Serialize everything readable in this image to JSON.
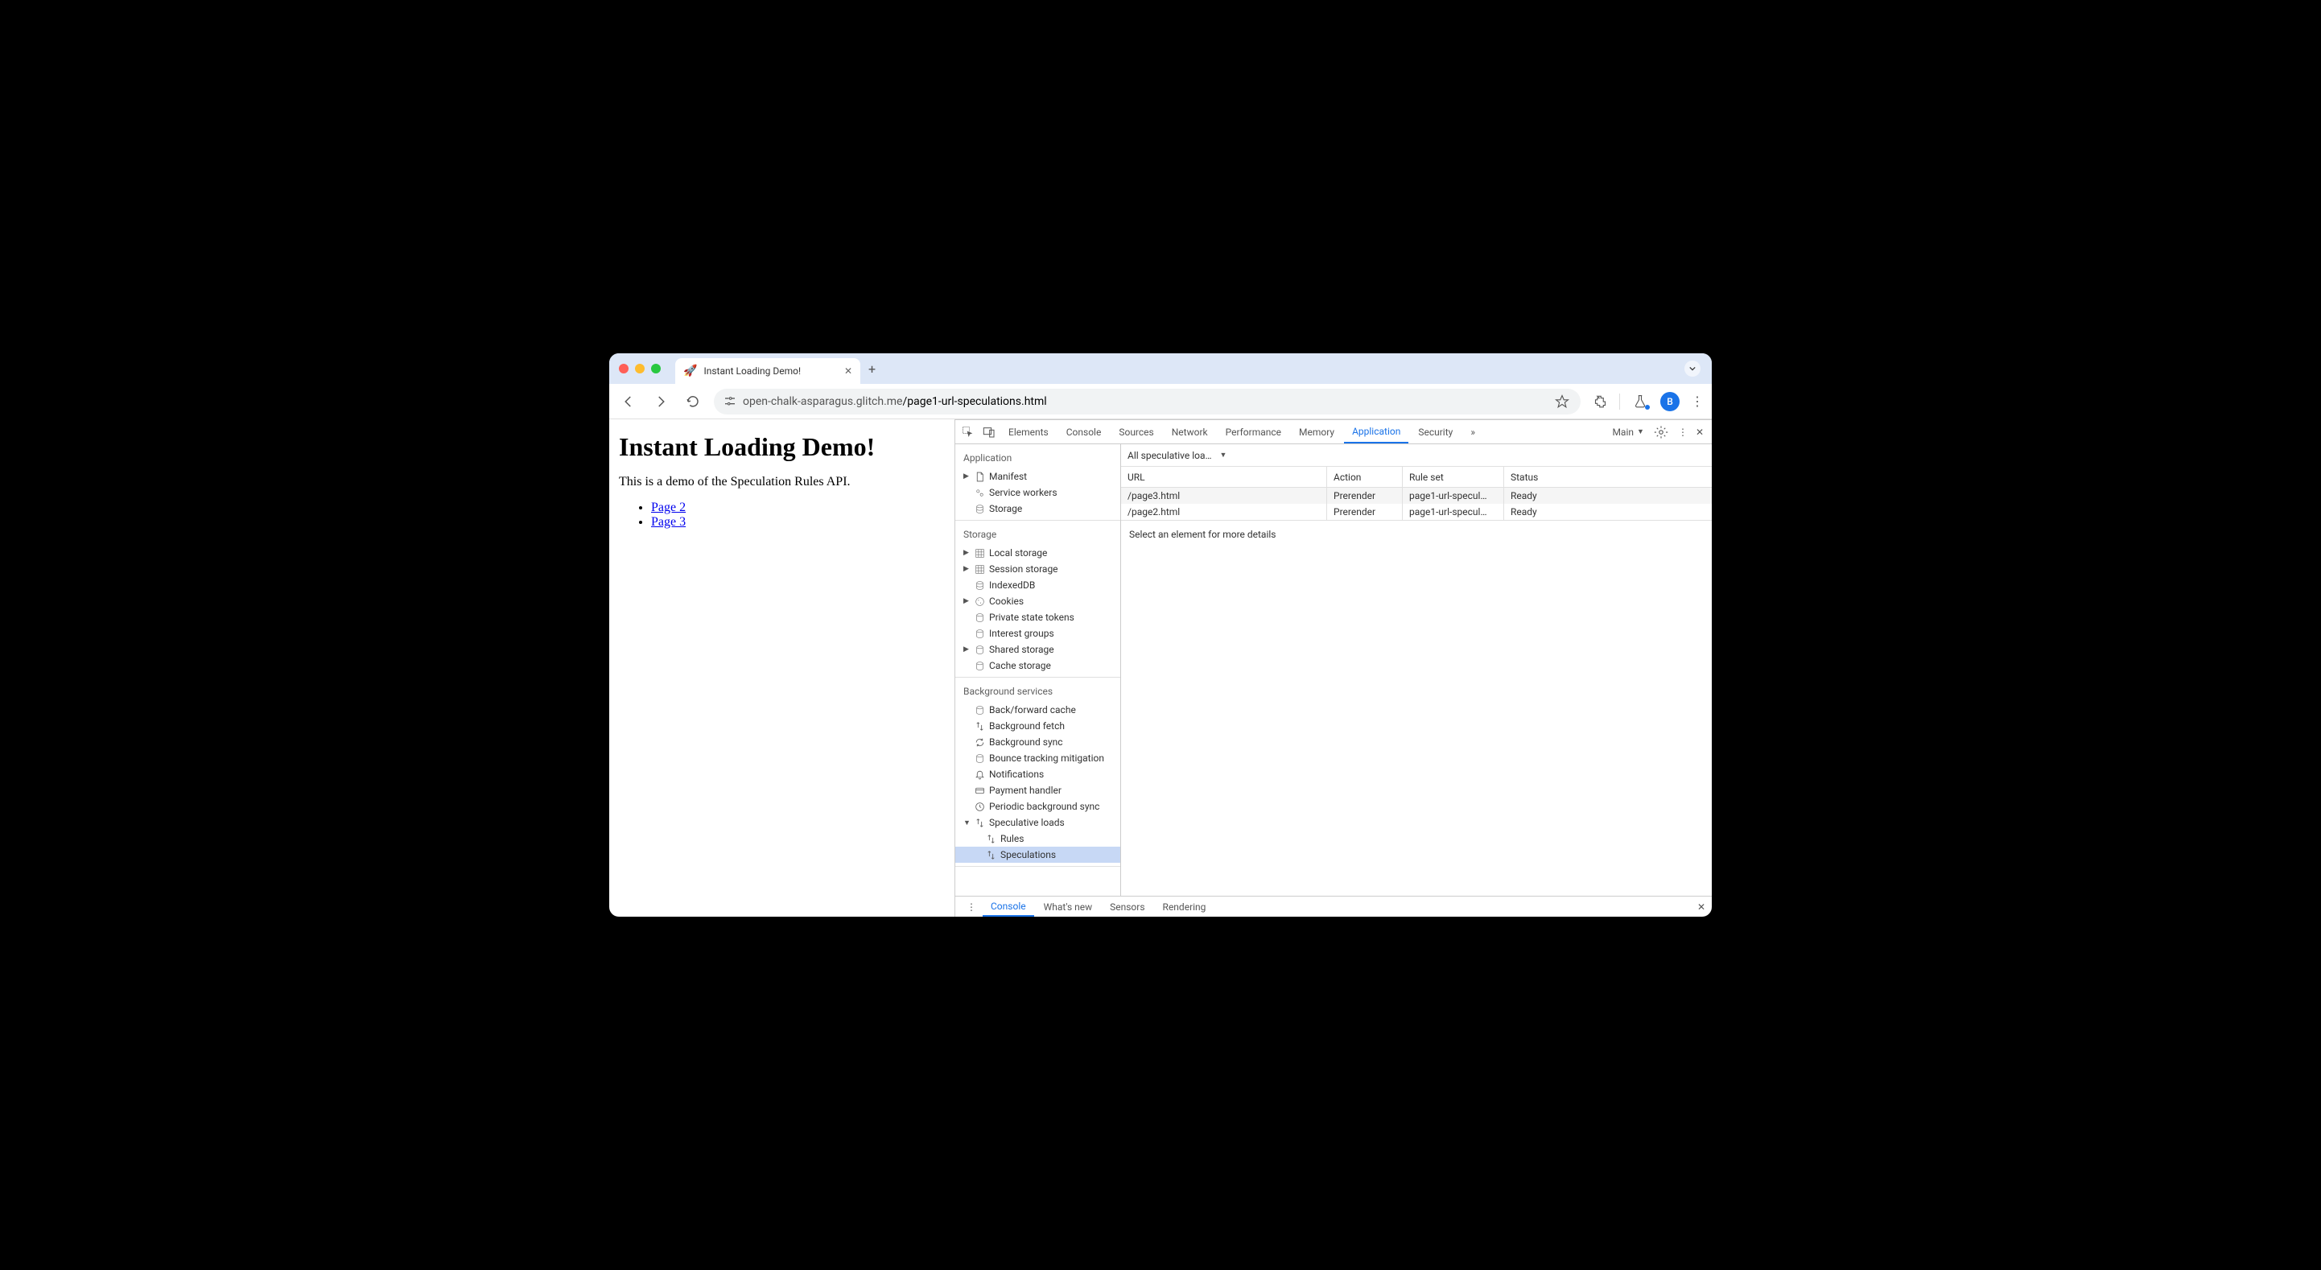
{
  "chrome": {
    "tab_title": "Instant Loading Demo!",
    "tab_favicon": "🚀",
    "url_host": "open-chalk-asparagus.glitch.me",
    "url_path": "/page1-url-speculations.html",
    "avatar_letter": "B"
  },
  "page": {
    "heading": "Instant Loading Demo!",
    "description": "This is a demo of the Speculation Rules API.",
    "links": [
      {
        "label": "Page 2"
      },
      {
        "label": "Page 3"
      }
    ]
  },
  "devtools": {
    "tabs": [
      "Elements",
      "Console",
      "Sources",
      "Network",
      "Performance",
      "Memory",
      "Application",
      "Security"
    ],
    "active_tab": "Application",
    "overflow": "»",
    "target_label": "Main",
    "sidebar": {
      "application": {
        "title": "Application",
        "items": [
          "Manifest",
          "Service workers",
          "Storage"
        ]
      },
      "storage": {
        "title": "Storage",
        "items": [
          "Local storage",
          "Session storage",
          "IndexedDB",
          "Cookies",
          "Private state tokens",
          "Interest groups",
          "Shared storage",
          "Cache storage"
        ]
      },
      "background": {
        "title": "Background services",
        "items": [
          "Back/forward cache",
          "Background fetch",
          "Background sync",
          "Bounce tracking mitigation",
          "Notifications",
          "Payment handler",
          "Periodic background sync",
          "Speculative loads"
        ],
        "spec_children": [
          "Rules",
          "Speculations"
        ],
        "selected": "Speculations"
      }
    },
    "filter_label": "All speculative loa…",
    "table": {
      "headers": [
        "URL",
        "Action",
        "Rule set",
        "Status"
      ],
      "rows": [
        {
          "url": "/page3.html",
          "action": "Prerender",
          "ruleset": "page1-url-specul…",
          "status": "Ready"
        },
        {
          "url": "/page2.html",
          "action": "Prerender",
          "ruleset": "page1-url-specul…",
          "status": "Ready"
        }
      ]
    },
    "details_hint": "Select an element for more details",
    "drawer": {
      "tabs": [
        "Console",
        "What's new",
        "Sensors",
        "Rendering"
      ],
      "active": "Console"
    }
  }
}
